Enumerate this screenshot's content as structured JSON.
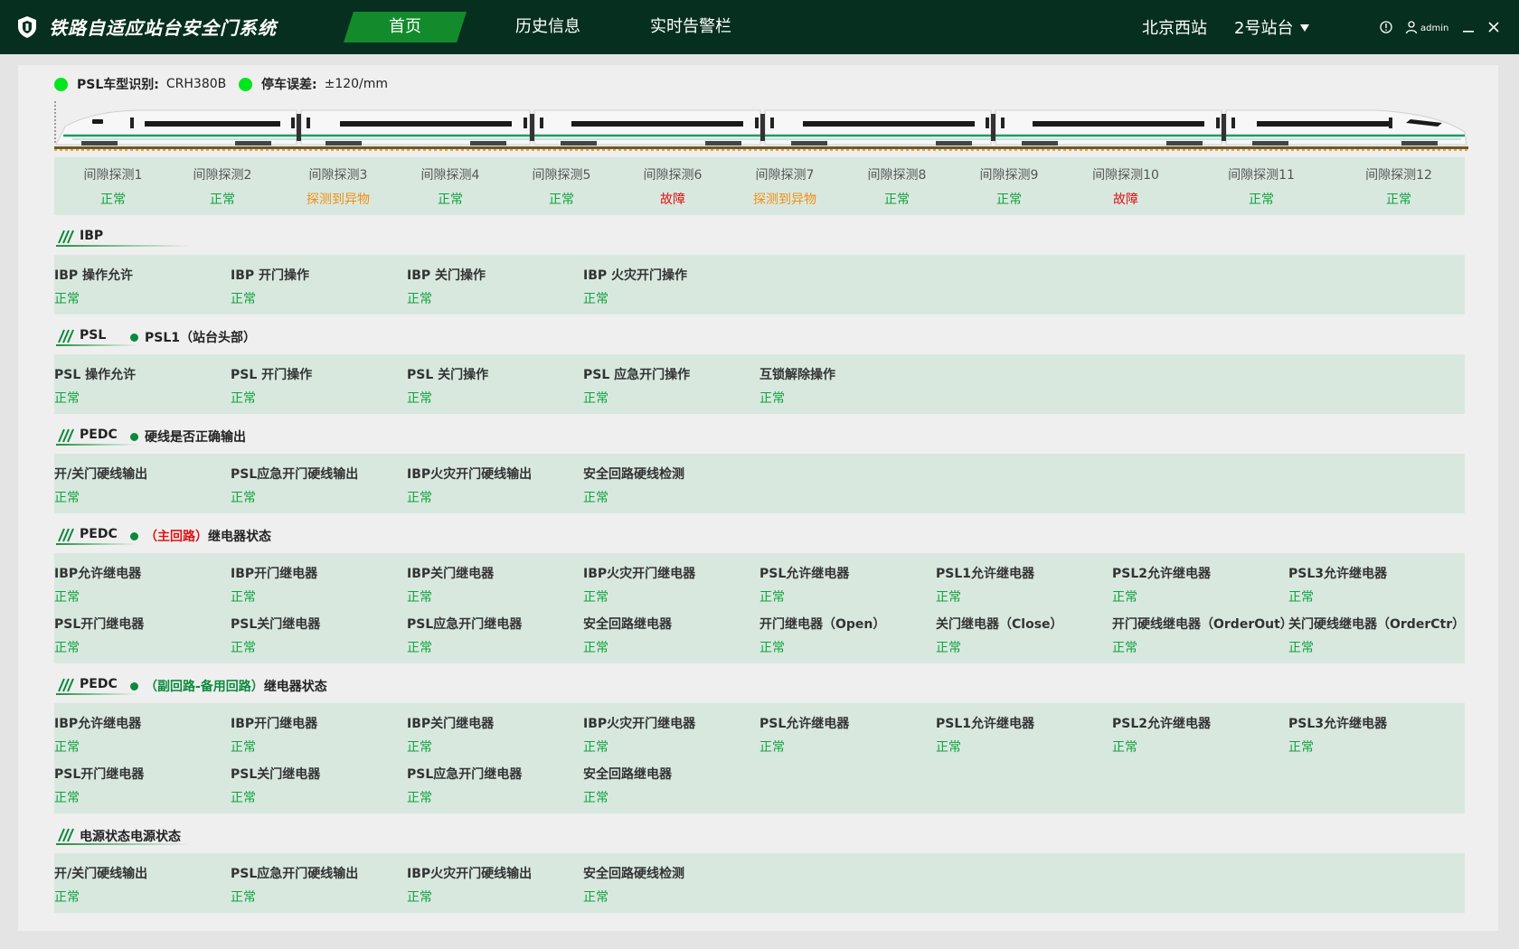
{
  "app_title": "铁路自适应站台安全门系统",
  "nav": [
    {
      "label": "首页",
      "active": true
    },
    {
      "label": "历史信息",
      "active": false
    },
    {
      "label": "实时告警栏",
      "active": false
    }
  ],
  "station": "北京西站",
  "platform": "2号站台",
  "user": "admin",
  "status_bar": {
    "psl_type_label": "PSL车型识别:",
    "psl_type_value": "CRH380B",
    "stop_error_label": "停车误差:",
    "stop_error_value": "±120/mm"
  },
  "gap_detections": [
    {
      "label": "间隙探测1",
      "status": "正常",
      "level": "ok"
    },
    {
      "label": "间隙探测2",
      "status": "正常",
      "level": "ok"
    },
    {
      "label": "间隙探测3",
      "status": "探测到异物",
      "level": "warn"
    },
    {
      "label": "间隙探测4",
      "status": "正常",
      "level": "ok"
    },
    {
      "label": "间隙探测5",
      "status": "正常",
      "level": "ok"
    },
    {
      "label": "间隙探测6",
      "status": "故障",
      "level": "err"
    },
    {
      "label": "间隙探测7",
      "status": "探测到异物",
      "level": "warn"
    },
    {
      "label": "间隙探测8",
      "status": "正常",
      "level": "ok"
    },
    {
      "label": "间隙探测9",
      "status": "正常",
      "level": "ok"
    },
    {
      "label": "间隙探测10",
      "status": "故障",
      "level": "err"
    },
    {
      "label": "间隙探测11",
      "status": "正常",
      "level": "ok"
    },
    {
      "label": "间隙探测12",
      "status": "正常",
      "level": "ok"
    }
  ],
  "sections": {
    "ibp": {
      "title": "IBP",
      "items": [
        {
          "label": "IBP 操作允许",
          "status": "正常"
        },
        {
          "label": "IBP 开门操作",
          "status": "正常"
        },
        {
          "label": "IBP 关门操作",
          "status": "正常"
        },
        {
          "label": "IBP 火灾开门操作",
          "status": "正常"
        }
      ]
    },
    "psl": {
      "title": "PSL",
      "sub": "PSL1（站台头部）",
      "items": [
        {
          "label": "PSL 操作允许",
          "status": "正常"
        },
        {
          "label": "PSL 开门操作",
          "status": "正常"
        },
        {
          "label": "PSL 关门操作",
          "status": "正常"
        },
        {
          "label": "PSL 应急开门操作",
          "status": "正常"
        },
        {
          "label": "互锁解除操作",
          "status": "正常"
        }
      ]
    },
    "pedc_hw": {
      "title": "PEDC",
      "sub": "硬线是否正确输出",
      "items": [
        {
          "label": "开/关门硬线输出",
          "status": "正常"
        },
        {
          "label": "PSL应急开门硬线输出",
          "status": "正常"
        },
        {
          "label": "IBP火灾开门硬线输出",
          "status": "正常"
        },
        {
          "label": "安全回路硬线检测",
          "status": "正常"
        }
      ]
    },
    "pedc_main": {
      "title": "PEDC",
      "sub_highlight": "（主回路）",
      "sub": "继电器状态",
      "items": [
        {
          "label": "IBP允许继电器",
          "status": "正常"
        },
        {
          "label": "IBP开门继电器",
          "status": "正常"
        },
        {
          "label": "IBP关门继电器",
          "status": "正常"
        },
        {
          "label": "IBP火灾开门继电器",
          "status": "正常"
        },
        {
          "label": "PSL允许继电器",
          "status": "正常"
        },
        {
          "label": "PSL1允许继电器",
          "status": "正常"
        },
        {
          "label": "PSL2允许继电器",
          "status": "正常"
        },
        {
          "label": "PSL3允许继电器",
          "status": "正常"
        },
        {
          "label": "PSL开门继电器",
          "status": "正常"
        },
        {
          "label": "PSL关门继电器",
          "status": "正常"
        },
        {
          "label": "PSL应急开门继电器",
          "status": "正常"
        },
        {
          "label": "安全回路继电器",
          "status": "正常"
        },
        {
          "label": "开门继电器（Open）",
          "status": "正常"
        },
        {
          "label": "关门继电器（Close）",
          "status": "正常"
        },
        {
          "label": "开门硬线继电器（OrderOut）",
          "status": "正常"
        },
        {
          "label": "关门硬线继电器（OrderCtr）",
          "status": "正常"
        }
      ]
    },
    "pedc_backup": {
      "title": "PEDC",
      "sub_highlight": "（副回路-备用回路）",
      "sub": "继电器状态",
      "items": [
        {
          "label": "IBP允许继电器",
          "status": "正常"
        },
        {
          "label": "IBP开门继电器",
          "status": "正常"
        },
        {
          "label": "IBP关门继电器",
          "status": "正常"
        },
        {
          "label": "IBP火灾开门继电器",
          "status": "正常"
        },
        {
          "label": "PSL允许继电器",
          "status": "正常"
        },
        {
          "label": "PSL1允许继电器",
          "status": "正常"
        },
        {
          "label": "PSL2允许继电器",
          "status": "正常"
        },
        {
          "label": "PSL3允许继电器",
          "status": "正常"
        },
        {
          "label": "PSL开门继电器",
          "status": "正常"
        },
        {
          "label": "PSL关门继电器",
          "status": "正常"
        },
        {
          "label": "PSL应急开门继电器",
          "status": "正常"
        },
        {
          "label": "安全回路继电器",
          "status": "正常"
        }
      ]
    },
    "power": {
      "title": "电源状态电源状态",
      "items": [
        {
          "label": "开/关门硬线输出",
          "status": "正常"
        },
        {
          "label": "PSL应急开门硬线输出",
          "status": "正常"
        },
        {
          "label": "IBP火灾开门硬线输出",
          "status": "正常"
        },
        {
          "label": "安全回路硬线检测",
          "status": "正常"
        }
      ]
    }
  },
  "colors": {
    "header_bg": "#062f20",
    "active_tab": "#138a2c",
    "ok": "#0fa23b",
    "warn": "#f18f12",
    "error": "#e01212",
    "row_bg": "#d8e8df"
  }
}
